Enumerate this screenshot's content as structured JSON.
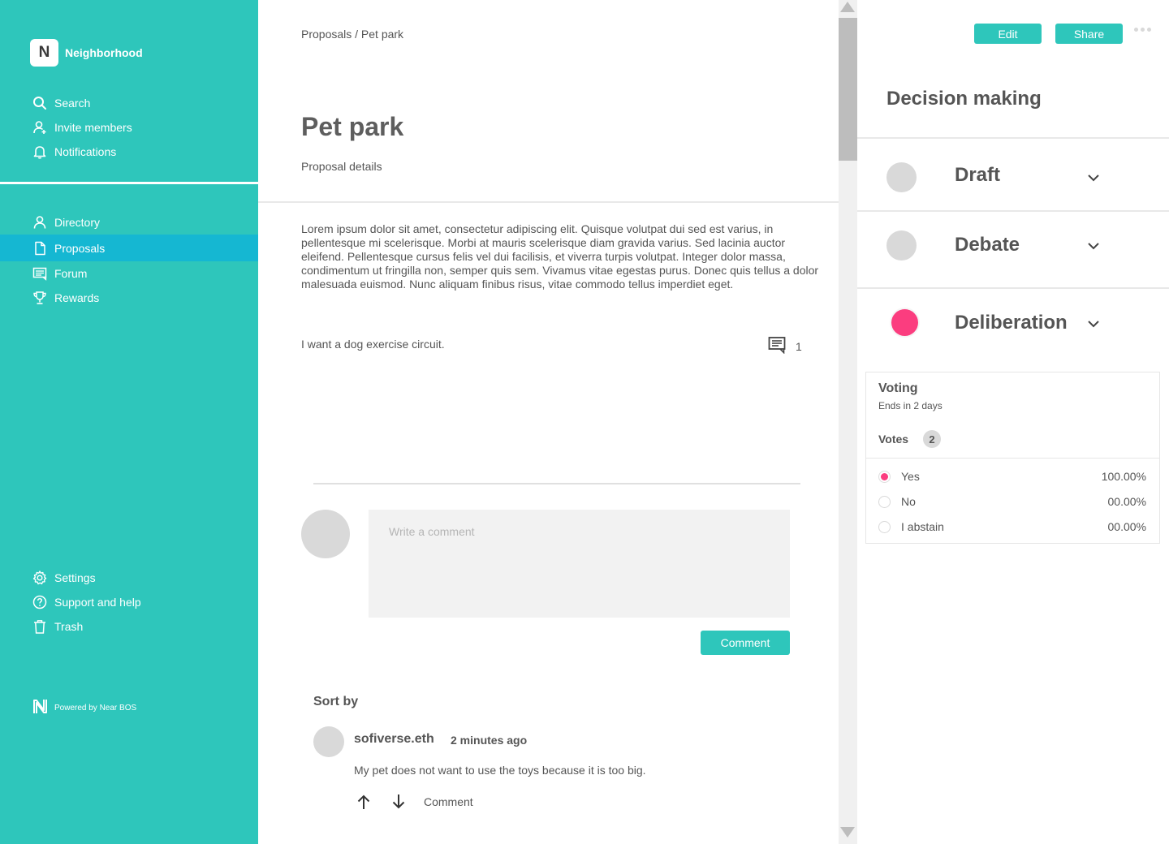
{
  "sidebar": {
    "brand_letter": "N",
    "brand_name": "Neighborhood",
    "top_items": [
      {
        "label": "Search",
        "icon": "search-icon"
      },
      {
        "label": "Invite members",
        "icon": "user-plus-icon"
      },
      {
        "label": "Notifications",
        "icon": "bell-icon"
      }
    ],
    "main_items": [
      {
        "label": "Directory",
        "icon": "user-icon"
      },
      {
        "label": "Proposals",
        "icon": "document-icon",
        "active": true
      },
      {
        "label": "Forum",
        "icon": "forum-icon"
      },
      {
        "label": "Rewards",
        "icon": "trophy-icon"
      }
    ],
    "bottom_items": [
      {
        "label": "Settings",
        "icon": "gear-icon"
      },
      {
        "label": "Support and help",
        "icon": "help-icon"
      },
      {
        "label": "Trash",
        "icon": "trash-icon"
      }
    ],
    "powered_by": "Powered by Near BOS"
  },
  "main": {
    "breadcrumb": "Proposals / Pet park",
    "title": "Pet park",
    "subtitle": "Proposal details",
    "body": "Lorem ipsum dolor sit amet, consectetur adipiscing elit. Quisque volutpat dui sed est varius, in pellentesque mi scelerisque. Morbi at mauris scelerisque diam gravida varius. Sed lacinia auctor eleifend. Pellentesque cursus felis vel dui facilisis, et viverra turpis volutpat. Integer dolor massa, condimentum ut fringilla non, semper quis sem. Vivamus vitae egestas purus. Donec quis tellus a dolor malesuada euismod. Nunc aliquam finibus risus, vitae commodo tellus imperdiet eget.",
    "proposal_line": "I want a dog exercise circuit.",
    "comment_count": "1",
    "comment_placeholder": "Write a comment",
    "comment_button": "Comment",
    "sort_by": "Sort by",
    "comments": [
      {
        "author": "sofiverse.eth",
        "time": "2 minutes ago",
        "text": "My pet does not want to use the toys because it is too big.",
        "reply_label": "Comment"
      }
    ]
  },
  "right_panel": {
    "edit_label": "Edit",
    "share_label": "Share",
    "title": "Decision making",
    "stages": [
      {
        "label": "Draft",
        "color": "#d9d9d9"
      },
      {
        "label": "Debate",
        "color": "#d9d9d9"
      },
      {
        "label": "Deliberation",
        "color": "#fb3d7f"
      }
    ],
    "voting": {
      "title": "Voting",
      "ends": "Ends in 2 days",
      "votes_label": "Votes",
      "votes_count": "2",
      "options": [
        {
          "label": "Yes",
          "value": "100.00%",
          "selected": true
        },
        {
          "label": "No",
          "value": "00.00%",
          "selected": false
        },
        {
          "label": "I abstain",
          "value": "00.00%",
          "selected": false
        }
      ]
    }
  },
  "colors": {
    "accent": "#2ec6bb",
    "active_nav": "#15b7d2",
    "pink": "#fb3d7f"
  }
}
